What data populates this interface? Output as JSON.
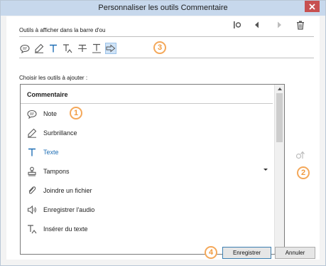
{
  "window": {
    "title": "Personnaliser les outils Commentaire"
  },
  "toolbar_section": {
    "label": "Outils à afficher dans la barre d'ou"
  },
  "toolbar_actions": [
    "move-to-start-icon",
    "move-left-icon",
    "move-right-icon",
    "trash-icon"
  ],
  "quick_tools": [
    {
      "icon": "note-icon",
      "selected": false
    },
    {
      "icon": "highlight-pen-icon",
      "selected": false
    },
    {
      "icon": "text-icon",
      "selected": false
    },
    {
      "icon": "insert-text-icon",
      "selected": false
    },
    {
      "icon": "strikethrough-icon",
      "selected": false
    },
    {
      "icon": "underline-icon",
      "selected": false
    },
    {
      "icon": "arrow-icon",
      "selected": true
    }
  ],
  "add_section": {
    "label": "Choisir les outils à ajouter :"
  },
  "list": {
    "header": "Commentaire",
    "items": [
      {
        "label": "Note",
        "icon": "note-icon"
      },
      {
        "label": "Surbrillance",
        "icon": "highlight-pen-icon"
      },
      {
        "label": "Texte",
        "icon": "text-icon",
        "accent": true
      },
      {
        "label": "Tampons",
        "icon": "stamp-icon",
        "has_dropdown": true
      },
      {
        "label": "Joindre un fichier",
        "icon": "attach-file-icon"
      },
      {
        "label": "Enregistrer l'audio",
        "icon": "record-audio-icon"
      },
      {
        "label": "Insérer du texte",
        "icon": "insert-text-icon"
      }
    ]
  },
  "callouts": [
    "1",
    "2",
    "3",
    "4"
  ],
  "buttons": {
    "save": "Enregistrer",
    "cancel": "Annuler"
  },
  "colors": {
    "titlebar": "#c7d8ec",
    "close": "#c75050",
    "accent": "#1f6fb5",
    "callout": "#f19a3e",
    "icon": "#5a5a5a"
  }
}
